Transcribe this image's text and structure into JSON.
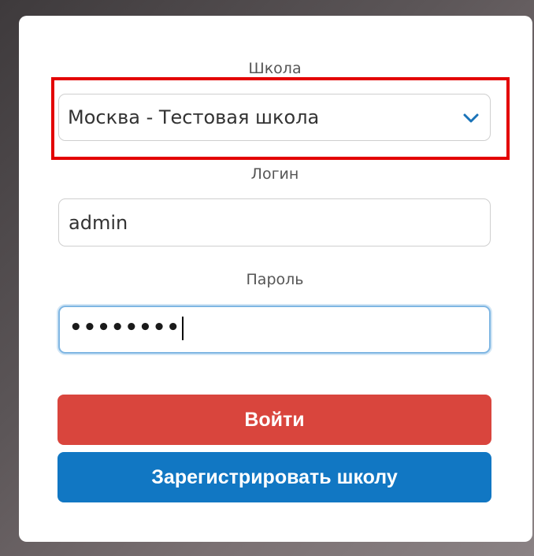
{
  "form": {
    "school_label": "Школа",
    "school_selected": "Москва - Тестовая школа",
    "login_label": "Логин",
    "login_value": "admin",
    "password_label": "Пароль",
    "password_masked": "••••••••",
    "login_button": "Войти",
    "register_button": "Зарегистрировать школу"
  },
  "icons": {
    "select_arrow": "chevron-down-icon"
  },
  "colors": {
    "login_button": "#d9453d",
    "register_button": "#1177c3",
    "highlight": "#e30000",
    "focus_border": "#7fb6e3"
  }
}
